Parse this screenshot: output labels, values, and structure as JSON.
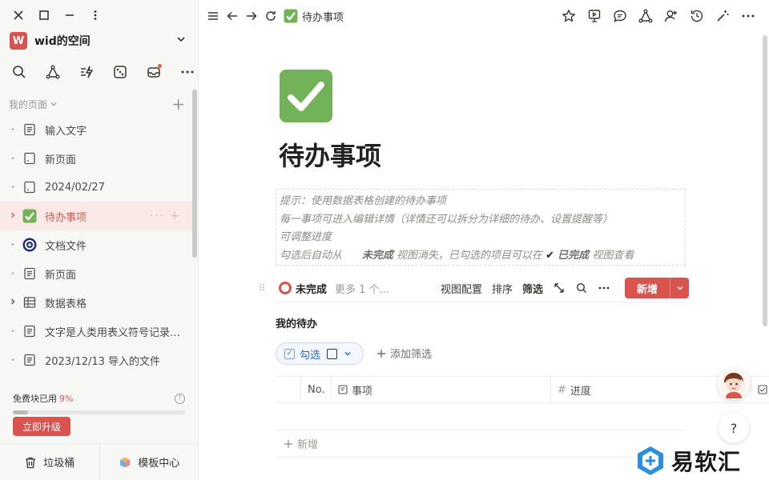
{
  "window": {
    "controls": [
      "close-icon",
      "maximize-icon",
      "minimize-icon",
      "more-vertical-icon"
    ]
  },
  "workspace": {
    "avatar_letter": "W",
    "name": "wid的空间",
    "accent": "#d9534f"
  },
  "sidebar": {
    "tools": [
      "search-icon",
      "graph-icon",
      "quick-action-icon",
      "dice-icon",
      "inbox-icon",
      "more-icon"
    ],
    "section_title": "我的页面",
    "items": [
      {
        "label": "输入文字",
        "icon": "doc-icon"
      },
      {
        "label": "新页面",
        "icon": "blank-page-icon"
      },
      {
        "label": "2024/02/27",
        "icon": "blank-page-icon"
      },
      {
        "label": "待办事项",
        "icon": "checkbox-icon",
        "active": true
      },
      {
        "label": "文档文件",
        "icon": "target-icon"
      },
      {
        "label": "新页面",
        "icon": "doc-icon"
      },
      {
        "label": "数据表格",
        "icon": "table-icon"
      },
      {
        "label": "文字是人类用表义符号记录表达信息以传之久远的方式和工具",
        "icon": "doc-icon"
      },
      {
        "label": "2023/12/13 导入的文件",
        "icon": "doc-icon"
      }
    ],
    "quota": {
      "label": "免费块已用",
      "percent": "9%",
      "fraction": 0.09
    },
    "upgrade_label": "立即升级",
    "trash_label": "垃圾桶",
    "templates_label": "模板中心"
  },
  "topbar": {
    "breadcrumb": "待办事项",
    "actions": [
      "star-icon",
      "presentation-icon",
      "comment-icon",
      "graph-icon",
      "add-user-icon",
      "history-icon",
      "magic-icon",
      "more-icon"
    ]
  },
  "page": {
    "title": "待办事项",
    "tips": [
      "提示：使用数据表格创建的待办事项",
      "每一事项可进入编辑详情（详情还可以拆分为详细的待办、设置提醒等）",
      "可调整进度"
    ],
    "tip_last": {
      "a": "勾选后自动从",
      "b": "未完成",
      "c": "视图消失，已勾选的项目可以在",
      "d": "✔",
      "e": "已完成",
      "f": "视图查看"
    }
  },
  "views": {
    "active": "未完成",
    "more": "更多 1 个...",
    "config": "视图配置",
    "sort": "排序",
    "filter": "筛选",
    "new_label": "新增"
  },
  "table": {
    "title": "我的待办",
    "filter_chip": "勾选",
    "add_filter": "添加筛选",
    "columns": [
      "No.",
      "事项",
      "进度"
    ],
    "add_row": "新增"
  },
  "brand": {
    "text": "易软汇"
  }
}
